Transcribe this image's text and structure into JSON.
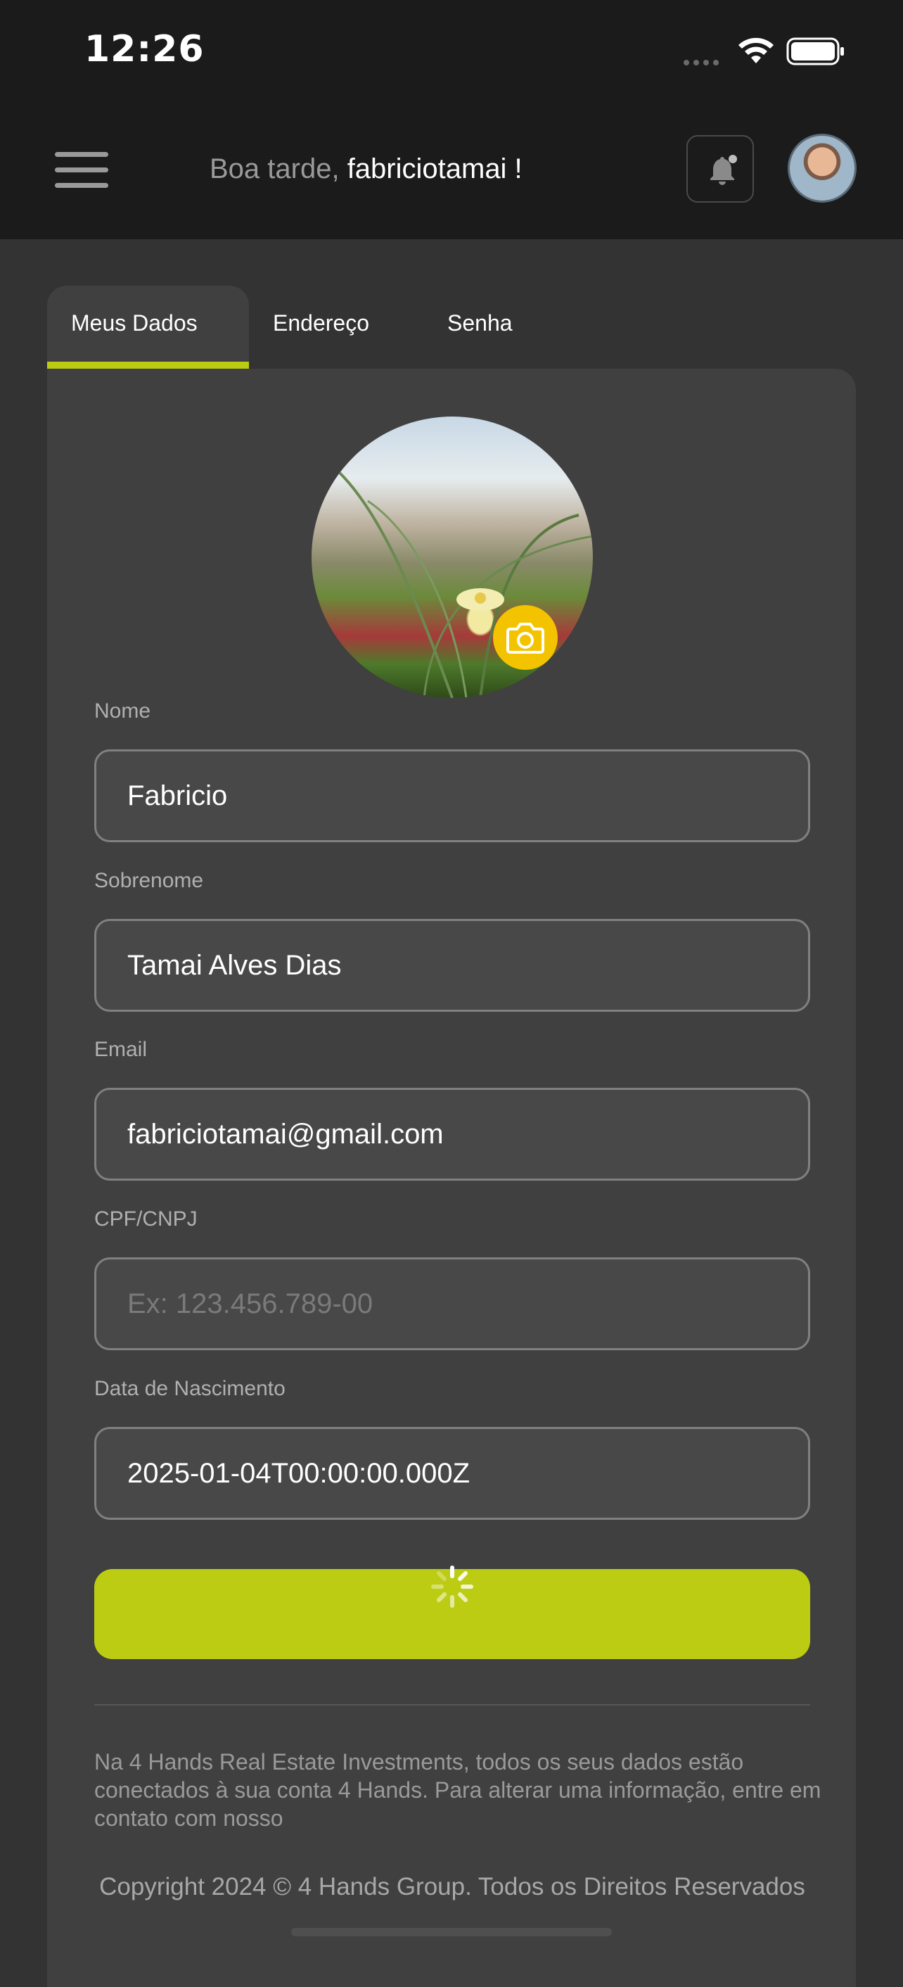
{
  "status_bar": {
    "time": "12:26"
  },
  "header": {
    "greeting_prefix": "Boa tarde, ",
    "username": "fabriciotamai !"
  },
  "tabs": [
    {
      "label": "Meus Dados",
      "active": true
    },
    {
      "label": "Endereço",
      "active": false
    },
    {
      "label": "Senha",
      "active": false
    }
  ],
  "form": {
    "nome": {
      "label": "Nome",
      "value": "Fabricio"
    },
    "sobrenome": {
      "label": "Sobrenome",
      "value": "Tamai Alves Dias"
    },
    "email": {
      "label": "Email",
      "value": "fabriciotamai@gmail.com"
    },
    "cpf": {
      "label": "CPF/CNPJ",
      "placeholder": "Ex: 123.456.789-00"
    },
    "nascimento": {
      "label": "Data de Nascimento",
      "value": "2025-01-04T00:00:00.000Z"
    }
  },
  "save_button": {
    "state": "loading"
  },
  "footer": {
    "info": "Na 4 Hands Real Estate Investments, todos os seus dados estão conectados à sua conta 4 Hands. Para alterar uma informação, entre em contato com nosso",
    "copyright": "Copyright 2024 © 4 Hands Group. Todos os Direitos Reservados"
  },
  "colors": {
    "accent": "#bccc13",
    "camera_button": "#f3c300",
    "background": "#333333",
    "card": "#404040",
    "appbar": "#1b1b1b"
  },
  "icons": {
    "menu": "hamburger-icon",
    "notifications": "bell-icon",
    "camera": "camera-icon",
    "loading": "spinner-icon"
  }
}
